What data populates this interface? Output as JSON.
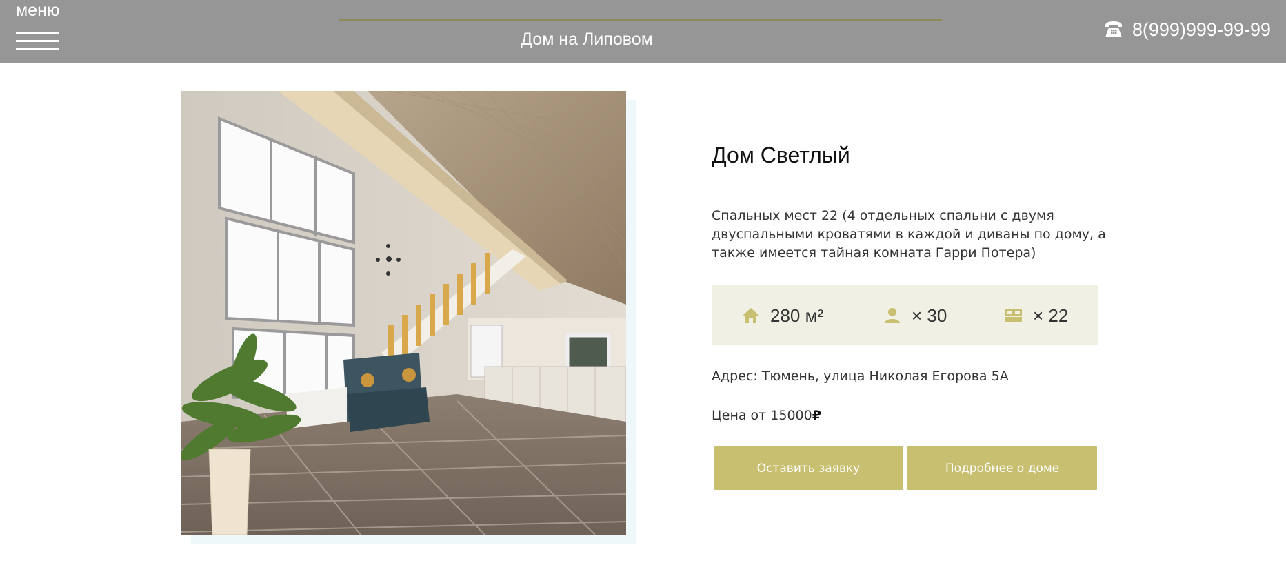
{
  "header": {
    "menu_label": "меню",
    "title": "Дом на Липовом",
    "phone": "8(999)999-99-99"
  },
  "house": {
    "title": "Дом Светлый",
    "description": "Спальных мест 22 (4 отдельных спальни с двумя двуспальными кроватями в каждой и диваны по дому, а также имеется тайная комната Гарри Потера)",
    "stats": {
      "area": "280 м²",
      "guests": "× 30",
      "beds": "× 22"
    },
    "address": "Адрес: Тюмень, улица Николая Егорова 5А",
    "price_text": "Цена от 15000",
    "currency": "₽"
  },
  "buttons": {
    "request": "Оставить заявку",
    "more": "Подробнее о доме"
  },
  "colors": {
    "header_bg": "#969696",
    "accent": "#c9bf70",
    "stats_bg": "#f0f0e4",
    "icon": "#c9bf70"
  },
  "icons": {
    "phone": "phone-icon",
    "area": "house-icon",
    "guests": "person-icon",
    "beds": "bed-icon",
    "menu": "hamburger-icon"
  }
}
